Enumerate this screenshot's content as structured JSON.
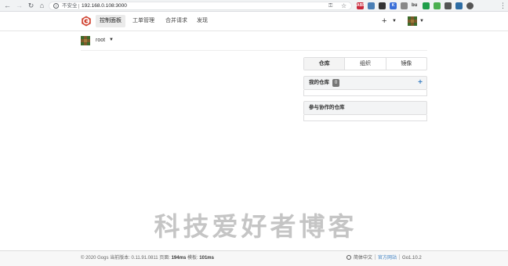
{
  "browser": {
    "insecure_label": "不安全",
    "url": "192.168.0.108:3000",
    "extensions": [
      {
        "name": "abp-icon",
        "label": "ABP",
        "color": "#c8283a"
      },
      {
        "name": "screenshot-icon",
        "label": "",
        "color": "#4a7fb5"
      },
      {
        "name": "search-ext-icon",
        "label": "",
        "color": "#333333"
      },
      {
        "name": "k-ext-icon",
        "label": "K",
        "color": "#3a6fd8"
      },
      {
        "name": "cloud-icon",
        "label": "",
        "color": "#888888"
      },
      {
        "name": "bu-ext-icon",
        "label": "bu",
        "color": "#333333"
      },
      {
        "name": "green-ext-icon",
        "label": "",
        "color": "#1e9e4a"
      },
      {
        "name": "evernote-icon",
        "label": "",
        "color": "#4caf50"
      },
      {
        "name": "save-ext-icon",
        "label": "",
        "color": "#555555"
      },
      {
        "name": "ext-blue-icon",
        "label": "",
        "color": "#2e6da4"
      },
      {
        "name": "profile-icon",
        "label": "",
        "color": "#555555"
      }
    ]
  },
  "header": {
    "nav": [
      "控制面板",
      "工单管理",
      "合并请求",
      "发现"
    ]
  },
  "context": {
    "user": "root"
  },
  "tabs": [
    "仓库",
    "组织",
    "镜像"
  ],
  "panels": {
    "my_repos": {
      "title": "我的仓库",
      "count": "0",
      "add": "+"
    },
    "collab_repos": {
      "title": "参与协作的仓库"
    }
  },
  "watermark": "科技爱好者博客",
  "footer": {
    "copyright": "© 2020 Gogs 当前版本: 0.11.91.0811 页面: ",
    "page_time": "194ms",
    "template_label": " 模板: ",
    "template_time": "101ms",
    "language": "简体中文",
    "official_site": "官方网站",
    "go_version": "Go1.10.2"
  },
  "colors": {
    "gogs_logo": "#d14836",
    "link": "#4183c4",
    "badge": "#767676"
  }
}
